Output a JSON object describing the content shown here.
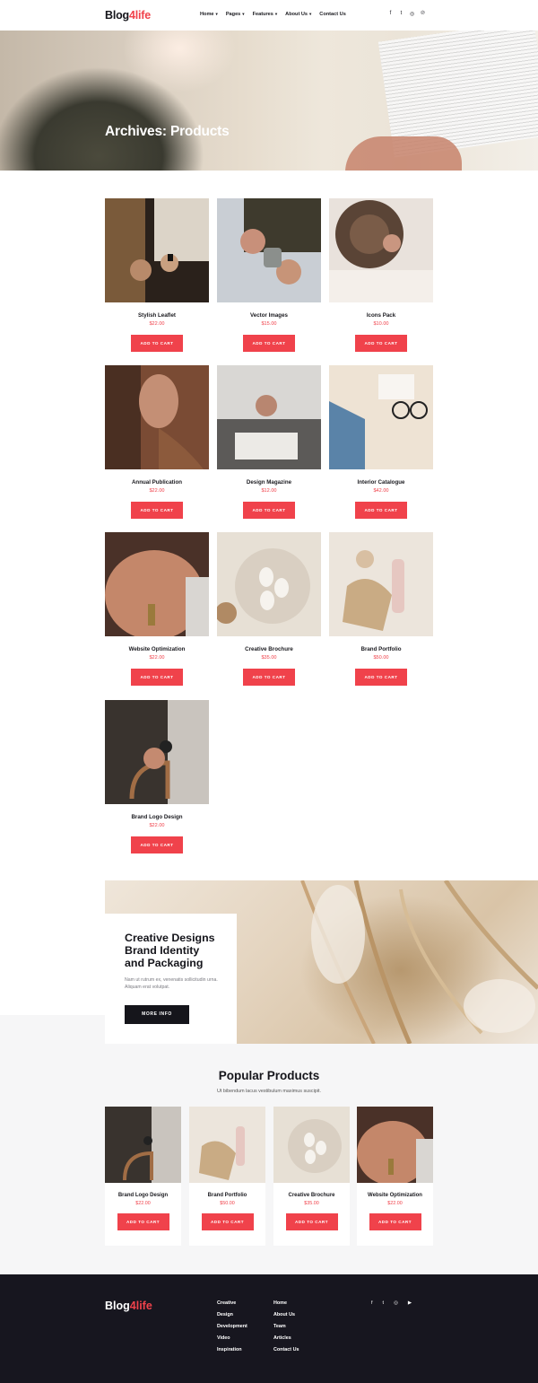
{
  "header": {
    "logo_main": "Blog",
    "logo_accent": "4life",
    "nav": [
      {
        "label": "Home",
        "caret": "▾"
      },
      {
        "label": "Pages",
        "caret": "▾"
      },
      {
        "label": "Features",
        "caret": "▾"
      },
      {
        "label": "About Us",
        "caret": "▾"
      },
      {
        "label": "Contact Us",
        "caret": ""
      }
    ],
    "social": [
      "f",
      "t",
      "◎",
      "℗"
    ]
  },
  "hero": {
    "title": "Archives: Products"
  },
  "products": [
    {
      "name": "Stylish Leaflet",
      "price": "$22.00",
      "button": "ADD TO CART"
    },
    {
      "name": "Vector Images",
      "price": "$15.00",
      "button": "ADD TO CART"
    },
    {
      "name": "Icons Pack",
      "price": "$10.00",
      "button": "ADD TO CART"
    },
    {
      "name": "Annual Publication",
      "price": "$22.00",
      "button": "ADD TO CART"
    },
    {
      "name": "Design Magazine",
      "price": "$12.00",
      "button": "ADD TO CART"
    },
    {
      "name": "Interior Catalogue",
      "price": "$42.00",
      "button": "ADD TO CART"
    },
    {
      "name": "Website Optimization",
      "price": "$22.00",
      "button": "ADD TO CART"
    },
    {
      "name": "Creative Brochure",
      "price": "$35.00",
      "button": "ADD TO CART"
    },
    {
      "name": "Brand Portfolio",
      "price": "$50.00",
      "button": "ADD TO CART"
    },
    {
      "name": "Brand Logo Design",
      "price": "$22.00",
      "button": "ADD TO CART"
    }
  ],
  "promo": {
    "title_1": "Creative Designs",
    "title_2": "Brand Identity",
    "title_3": "and Packaging",
    "text": "Nam ut rutrum ex, venenatis sollicitudin urna. Aliquam erat volutpat.",
    "button": "MORE INFO"
  },
  "popular": {
    "title": "Popular Products",
    "subtitle": "Ut bibendum lacus vestibulum maximus suscipit.",
    "items": [
      {
        "name": "Brand Logo Design",
        "price": "$22.00",
        "button": "ADD TO CART"
      },
      {
        "name": "Brand Portfolio",
        "price": "$50.00",
        "button": "ADD TO CART"
      },
      {
        "name": "Creative Brochure",
        "price": "$35.00",
        "button": "ADD TO CART"
      },
      {
        "name": "Website Optimization",
        "price": "$22.00",
        "button": "ADD TO CART"
      }
    ]
  },
  "footer": {
    "logo_main": "Blog",
    "logo_accent": "4life",
    "col1": [
      "Creative",
      "Design",
      "Development",
      "Video",
      "Inspiration"
    ],
    "col2": [
      "Home",
      "About Us",
      "Team",
      "Articles",
      "Contact Us"
    ],
    "social": [
      "f",
      "t",
      "◎",
      "▶"
    ]
  },
  "colors": {
    "accent": "#f0424b",
    "dark": "#17161f",
    "grey_bg": "#f6f6f7"
  }
}
